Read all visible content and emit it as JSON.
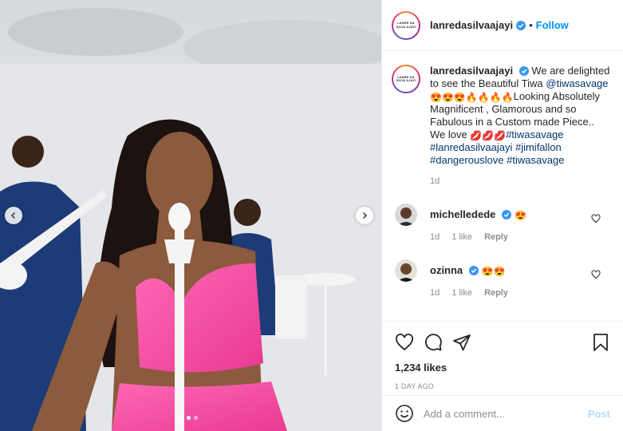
{
  "post": {
    "username": "lanredasilvaajayi",
    "follow_label": "Follow",
    "separator": "•",
    "logo_text": "LANRE DA SILVA AJAYI",
    "caption": {
      "text_intro": "We are delighted to see the Beautiful Tiwa",
      "mention": "@tiwasavage",
      "emojis_1": "😍😍😍🔥🔥🔥🔥",
      "text_body": "Looking Absolutely Magnificent , Glamorous and so Fabulous in a Custom made Piece..",
      "love_text": "We love",
      "lips": "💋💋💋",
      "hashtags": [
        "#tiwasavage",
        "#lanredasilvaajayi",
        "#jimifallon",
        "#dangerouslove",
        "#tiwasavage"
      ],
      "age": "1d"
    },
    "comments": [
      {
        "username": "michelledede",
        "text": "😍",
        "age": "1d",
        "likes": "1 like",
        "reply": "Reply"
      },
      {
        "username": "ozinna",
        "text": "😍😍",
        "age": "1d",
        "likes": "1 like",
        "reply": "Reply"
      }
    ],
    "likes": "1,234 likes",
    "date": "1 DAY AGO",
    "add_comment_placeholder": "Add a comment...",
    "post_label": "Post",
    "carousel": {
      "total": 3,
      "active": 2
    }
  },
  "colors": {
    "accent": "#0095f6",
    "dress": "#f0479b",
    "post_disabled": "#b2dffc"
  },
  "icons": [
    "chevron-left-icon",
    "chevron-right-icon",
    "verified-badge-icon",
    "heart-icon",
    "comment-icon",
    "share-icon",
    "bookmark-icon",
    "smiley-icon"
  ]
}
